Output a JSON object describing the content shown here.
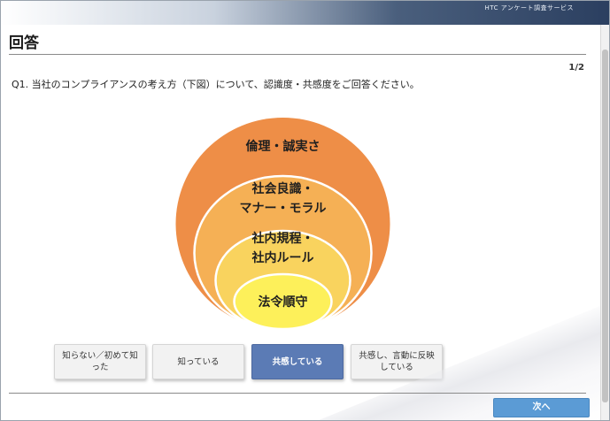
{
  "header": {
    "service_name": "HTC アンケート調査サービス"
  },
  "page": {
    "title": "回答",
    "pager": "1/2",
    "question": "Q1. 当社のコンプライアンスの考え方（下図）について、認識度・共感度をご回答ください。"
  },
  "diagram": {
    "rings": [
      {
        "label_line1": "倫理・誠実さ",
        "label_line2": "",
        "color": "#ee8e47"
      },
      {
        "label_line1": "社会良識・",
        "label_line2": "マナー・モラル",
        "color": "#f5b055"
      },
      {
        "label_line1": "社内規程・",
        "label_line2": "社内ルール",
        "color": "#f9d35e"
      },
      {
        "label_line1": "法令順守",
        "label_line2": "",
        "color": "#fdf05a"
      }
    ]
  },
  "options": [
    {
      "label_line1": "知らない／初めて知",
      "label_line2": "った",
      "selected": false
    },
    {
      "label_line1": "知っている",
      "label_line2": "",
      "selected": false
    },
    {
      "label_line1": "共感している",
      "label_line2": "",
      "selected": true
    },
    {
      "label_line1": "共感し、言動に反映",
      "label_line2": "している",
      "selected": false
    }
  ],
  "footer": {
    "next_label": "次へ"
  },
  "colors": {
    "selected_option": "#5b7bb5",
    "next_button": "#5b9bd5"
  }
}
